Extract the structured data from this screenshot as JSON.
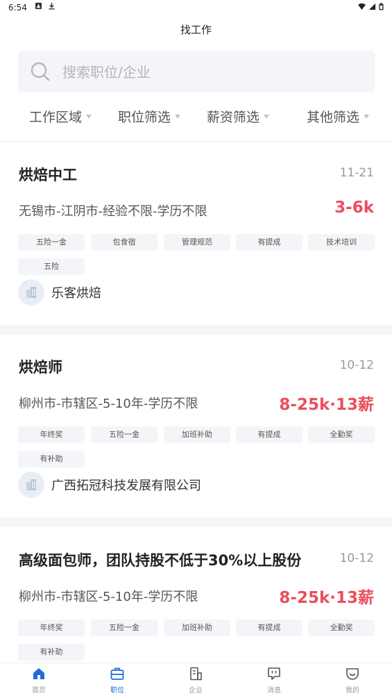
{
  "status_bar": {
    "time": "6:54"
  },
  "header": {
    "title": "找工作"
  },
  "search": {
    "placeholder": "搜索职位/企业",
    "value": ""
  },
  "filters": [
    {
      "label": "工作区域"
    },
    {
      "label": "职位筛选"
    },
    {
      "label": "薪资筛选"
    },
    {
      "label": "其他筛选"
    }
  ],
  "jobs": [
    {
      "title": "烘焙中工",
      "date": "11-21",
      "meta": "无锡市-江阴市-经验不限-学历不限",
      "salary": "3-6k",
      "tags": [
        "五险一金",
        "包食宿",
        "管理规范",
        "有提成",
        "技术培训",
        "五险"
      ],
      "company": "乐客烘焙"
    },
    {
      "title": "烘焙师",
      "date": "10-12",
      "meta": "柳州市-市辖区-5-10年-学历不限",
      "salary": "8-25k·13薪",
      "tags": [
        "年终奖",
        "五险一金",
        "加班补助",
        "有提成",
        "全勤奖",
        "有补助"
      ],
      "company": "广西拓冠科技发展有限公司"
    },
    {
      "title": "高级面包师，团队持股不低于30%以上股份",
      "date": "10-12",
      "meta": "柳州市-市辖区-5-10年-学历不限",
      "salary": "8-25k·13薪",
      "tags": [
        "年终奖",
        "五险一金",
        "加班补助",
        "有提成",
        "全勤奖",
        "有补助"
      ],
      "company": ""
    }
  ],
  "tabbar": {
    "active": "职位",
    "items": [
      {
        "label": "首页",
        "icon": "home-icon"
      },
      {
        "label": "职位",
        "icon": "briefcase-icon"
      },
      {
        "label": "企业",
        "icon": "building-icon"
      },
      {
        "label": "消息",
        "icon": "message-icon"
      },
      {
        "label": "我的",
        "icon": "profile-icon"
      }
    ]
  },
  "colors": {
    "salary": "#ec4d5c",
    "accent": "#1f6bdb",
    "tag_bg": "#f4f5f8",
    "search_bg": "#f4f5f9"
  }
}
